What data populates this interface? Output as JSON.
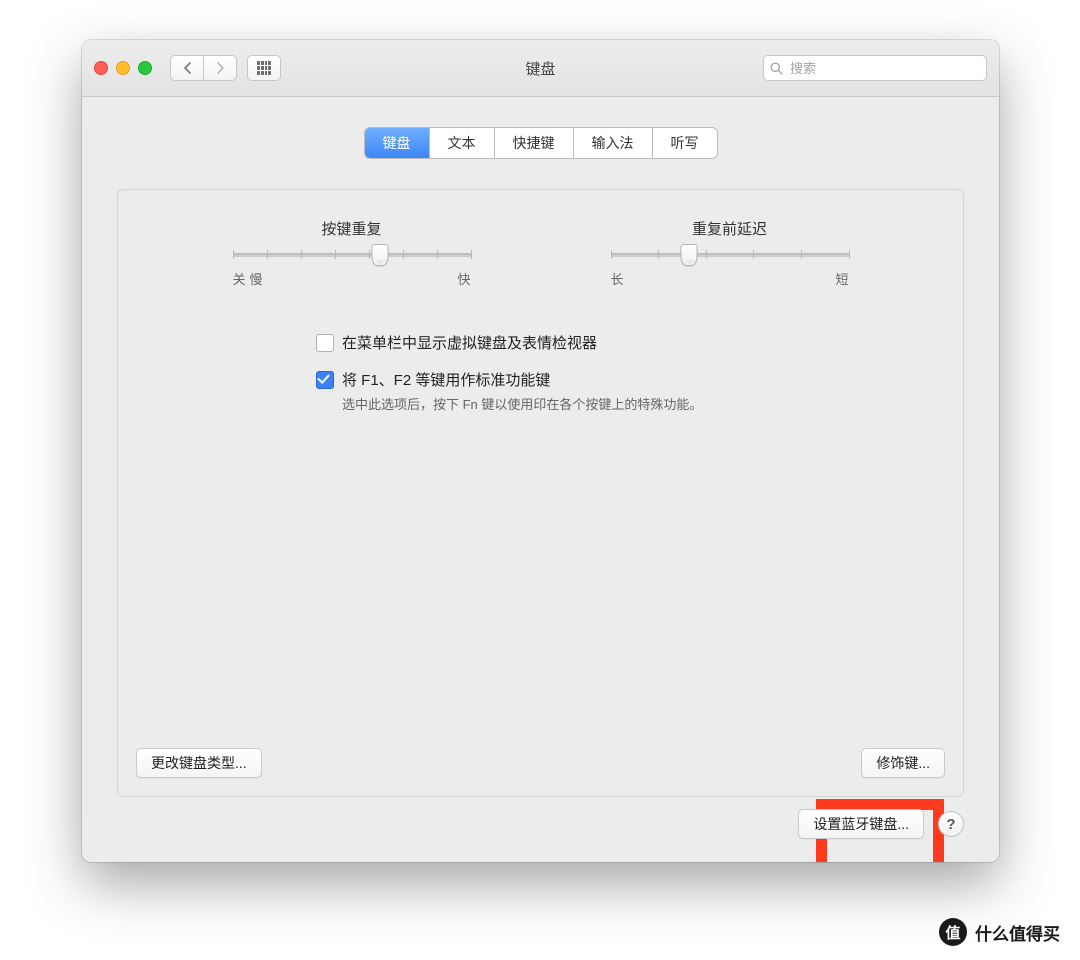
{
  "window": {
    "title": "键盘"
  },
  "toolbar": {
    "search_placeholder": "搜索"
  },
  "tabs": {
    "items": [
      "键盘",
      "文本",
      "快捷键",
      "输入法",
      "听写"
    ],
    "active_index": 0
  },
  "slider_repeat": {
    "label": "按键重复",
    "left": "关",
    "mid_left": "慢",
    "right": "快",
    "value_pct": 62,
    "ticks": 8
  },
  "slider_delay": {
    "label": "重复前延迟",
    "left": "长",
    "right": "短",
    "value_pct": 33,
    "ticks": 6
  },
  "options": {
    "show_keyboard_viewer": {
      "checked": false,
      "label": "在菜单栏中显示虚拟键盘及表情检视器"
    },
    "fn_keys": {
      "checked": true,
      "label": "将 F1、F2 等键用作标准功能键",
      "sub": "选中此选项后，按下 Fn 键以使用印在各个按键上的特殊功能。"
    }
  },
  "buttons": {
    "change_type": "更改键盘类型...",
    "modifier": "修饰键...",
    "bluetooth": "设置蓝牙键盘...",
    "help": "?"
  },
  "watermark": {
    "char": "值",
    "text": "什么值得买"
  }
}
